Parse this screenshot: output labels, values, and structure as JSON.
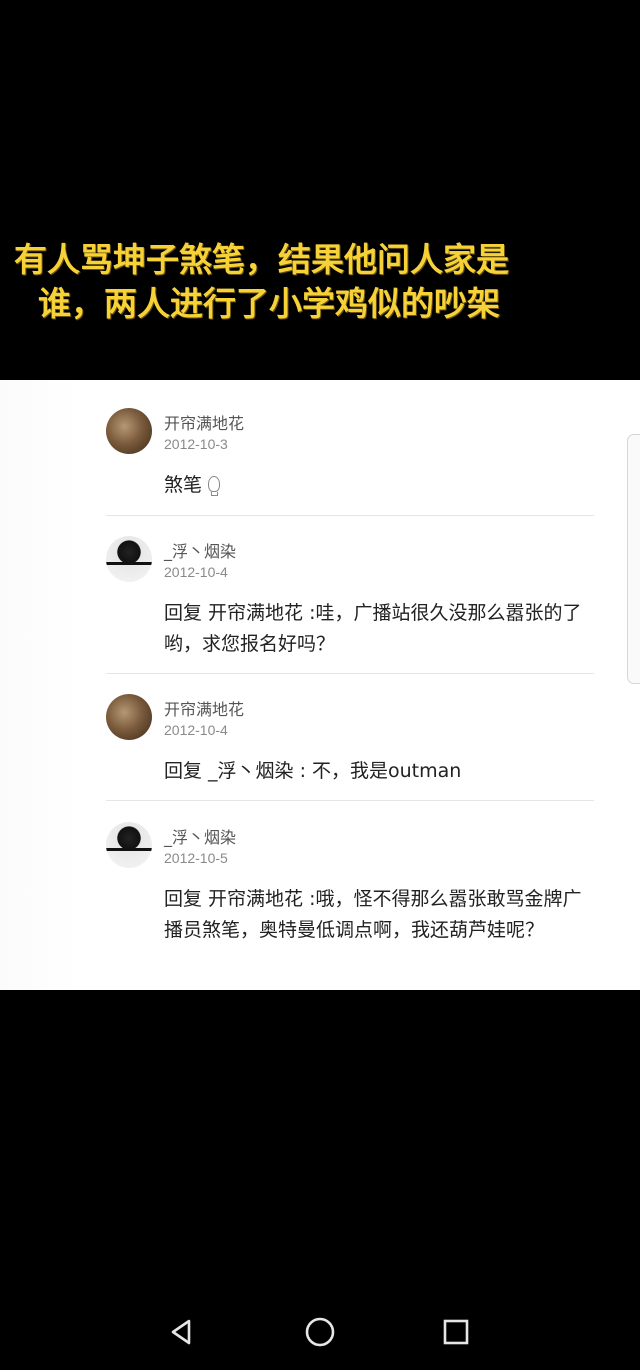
{
  "caption": {
    "line1": "有人骂坤子煞笔，结果他问人家是",
    "line2": "谁，两人进行了小学鸡似的吵架"
  },
  "comments": [
    {
      "user": "开帘满地花",
      "date": "2012-10-3",
      "text": "煞笔",
      "avatar": "avatar-brown"
    },
    {
      "user": "_浮丶烟染",
      "date": "2012-10-4",
      "text": "回复 开帘满地花 :哇，广播站很久没那么嚣张的了哟，求您报名好吗？",
      "avatar": "avatar-bw"
    },
    {
      "user": "开帘满地花",
      "date": "2012-10-4",
      "text": "回复 _浮丶烟染 : 不，我是outman",
      "avatar": "avatar-brown"
    },
    {
      "user": "_浮丶烟染",
      "date": "2012-10-5",
      "text": "回复 开帘满地花 :哦，怪不得那么嚣张敢骂金牌广播员煞笔，奥特曼低调点啊，我还葫芦娃呢？",
      "avatar": "avatar-bw"
    }
  ],
  "navbar": {
    "back_icon": "triangle-back-icon",
    "home_icon": "circle-home-icon",
    "recents_icon": "square-recents-icon"
  },
  "colors": {
    "background": "#000000",
    "caption": "#f6d238",
    "panel": "#ffffff"
  }
}
